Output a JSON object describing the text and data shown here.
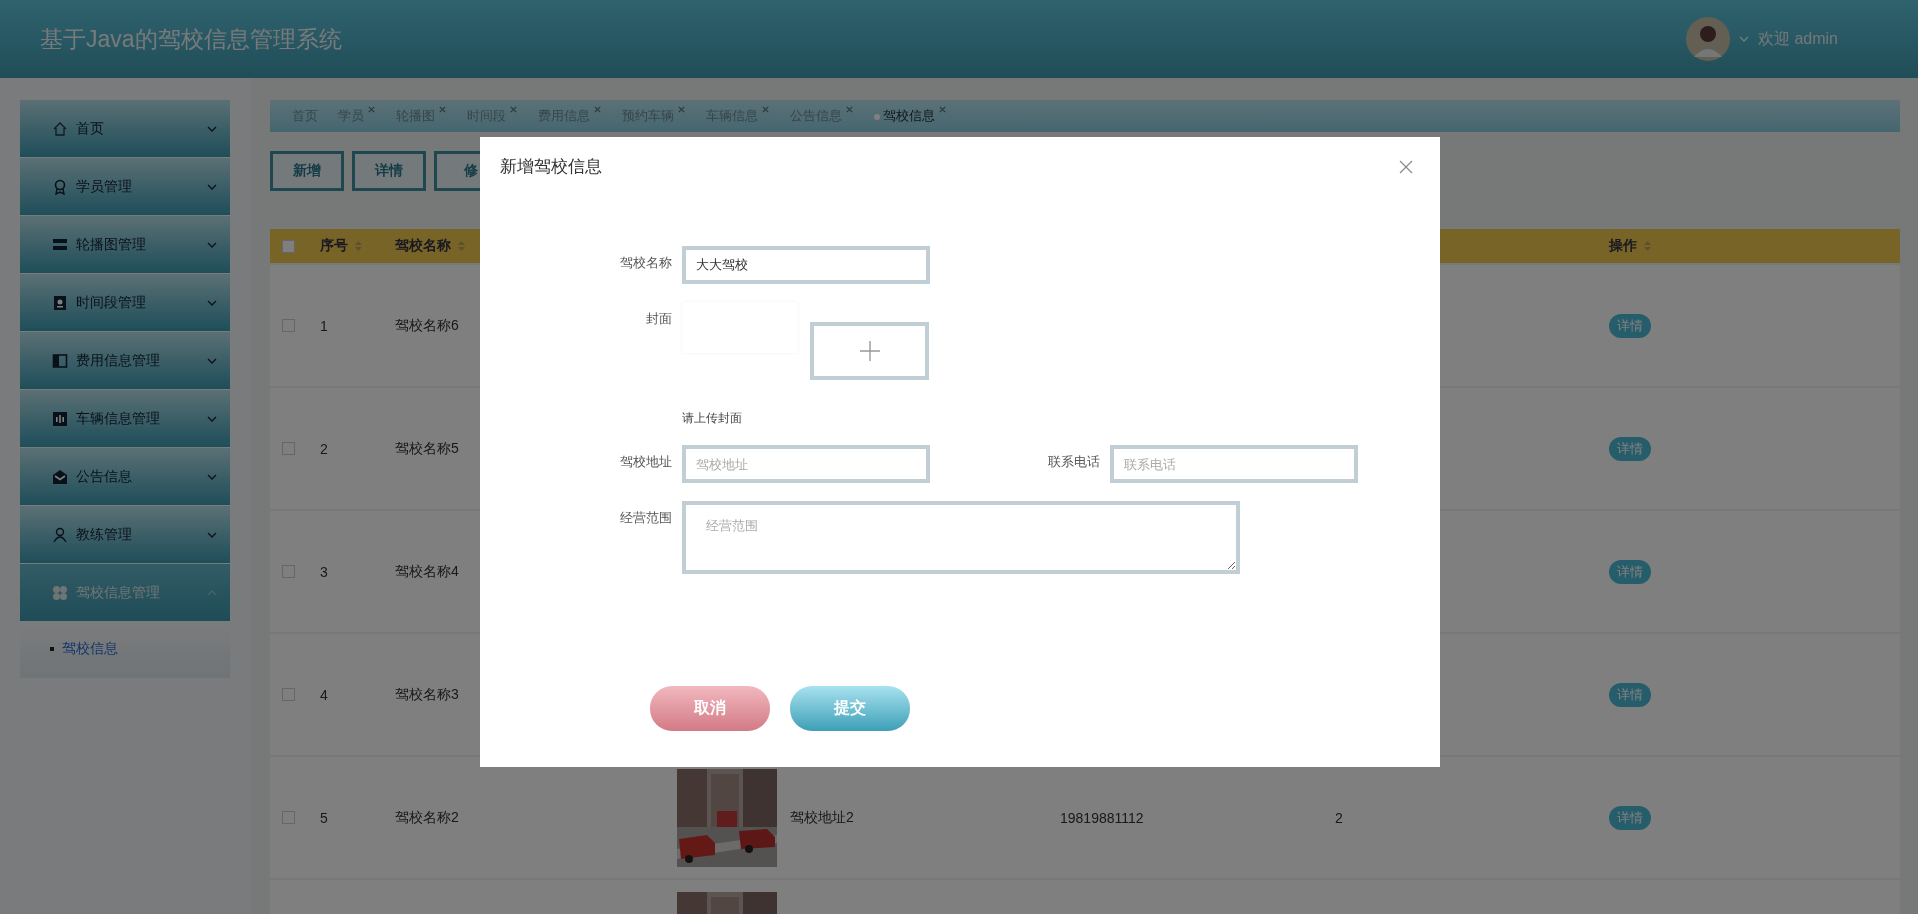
{
  "header": {
    "title": "基于Java的驾校信息管理系统",
    "greeting": "欢迎 admin"
  },
  "sidebar": {
    "items": [
      {
        "label": "首页",
        "expanded": false
      },
      {
        "label": "学员管理",
        "expanded": false
      },
      {
        "label": "轮播图管理",
        "expanded": false
      },
      {
        "label": "时间段管理",
        "expanded": false
      },
      {
        "label": "费用信息管理",
        "expanded": false
      },
      {
        "label": "车辆信息管理",
        "expanded": false
      },
      {
        "label": "公告信息",
        "expanded": false
      },
      {
        "label": "教练管理",
        "expanded": false
      },
      {
        "label": "驾校信息管理",
        "expanded": true,
        "children": [
          {
            "label": "驾校信息",
            "selected": true
          }
        ]
      }
    ]
  },
  "tabs": [
    {
      "label": "首页",
      "closable": false,
      "selected": false
    },
    {
      "label": "学员",
      "closable": true,
      "selected": false
    },
    {
      "label": "轮播图",
      "closable": true,
      "selected": false
    },
    {
      "label": "时间段",
      "closable": true,
      "selected": false
    },
    {
      "label": "费用信息",
      "closable": true,
      "selected": false
    },
    {
      "label": "预约车辆",
      "closable": true,
      "selected": false
    },
    {
      "label": "车辆信息",
      "closable": true,
      "selected": false
    },
    {
      "label": "公告信息",
      "closable": true,
      "selected": false
    },
    {
      "label": "驾校信息",
      "closable": true,
      "selected": true
    }
  ],
  "toolbar": {
    "buttons": [
      "新增",
      "详情",
      "修"
    ]
  },
  "table": {
    "columns": {
      "select": {
        "checked": false
      },
      "index": "序号",
      "name": "驾校名称",
      "action": "操作"
    },
    "rows": [
      {
        "checked": false,
        "index": "1",
        "name": "驾校名称6",
        "action": "详情"
      },
      {
        "checked": false,
        "index": "2",
        "name": "驾校名称5",
        "action": "详情"
      },
      {
        "checked": false,
        "index": "3",
        "name": "驾校名称4",
        "action": "详情"
      },
      {
        "checked": false,
        "index": "4",
        "name": "驾校名称3",
        "action": "详情"
      },
      {
        "checked": false,
        "index": "5",
        "name": "驾校名称2",
        "cover": {
          "kind": "picture"
        },
        "address": "驾校地址2",
        "phone": "19819881112",
        "column_7": "2",
        "action": "详情"
      },
      {
        "cover": {
          "kind": "picture"
        }
      }
    ]
  },
  "dialog": {
    "title": "新增驾校信息",
    "fields": [
      {
        "kind": "text",
        "label": "驾校名称",
        "value": "大大驾校"
      },
      {
        "kind": "upload",
        "label": "封面",
        "hint": "请上传封面"
      },
      {
        "kind": "text",
        "label": "驾校地址",
        "placeholder": "驾校地址"
      },
      {
        "kind": "text",
        "label": "联系电话",
        "placeholder": "联系电话"
      },
      {
        "kind": "textarea",
        "label": "经营范围",
        "placeholder": "经营范围"
      }
    ],
    "buttons": [
      {
        "kind": "cancel",
        "label": "取消"
      },
      {
        "kind": "submit",
        "label": "提交"
      }
    ]
  }
}
